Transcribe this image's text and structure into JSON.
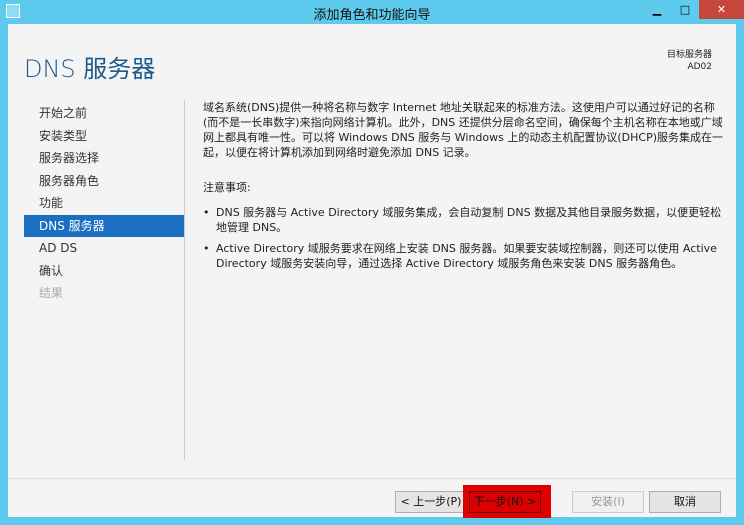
{
  "window": {
    "title": "添加角色和功能向导",
    "minimize": "▁",
    "maximize": "□",
    "close": "✕"
  },
  "header": {
    "title": "DNS 服务器",
    "target_label": "目标服务器",
    "target_value": "AD02"
  },
  "nav": [
    {
      "label": "开始之前",
      "state": "normal"
    },
    {
      "label": "安装类型",
      "state": "normal"
    },
    {
      "label": "服务器选择",
      "state": "normal"
    },
    {
      "label": "服务器角色",
      "state": "normal"
    },
    {
      "label": "功能",
      "state": "normal"
    },
    {
      "label": "DNS 服务器",
      "state": "selected"
    },
    {
      "label": "AD DS",
      "state": "normal"
    },
    {
      "label": "确认",
      "state": "normal"
    },
    {
      "label": "结果",
      "state": "disabled"
    }
  ],
  "content": {
    "intro": "域名系统(DNS)提供一种将名称与数字 Internet 地址关联起来的标准方法。这使用户可以通过好记的名称(而不是一长串数字)来指向网络计算机。此外，DNS 还提供分层命名空间，确保每个主机名称在本地或广域网上都具有唯一性。可以将 Windows DNS 服务与 Windows 上的动态主机配置协议(DHCP)服务集成在一起，以便在将计算机添加到网络时避免添加 DNS 记录。",
    "notes_title": "注意事项:",
    "notes": [
      "DNS 服务器与 Active Directory 域服务集成，会自动复制 DNS 数据及其他目录服务数据，以便更轻松地管理 DNS。",
      "Active Directory 域服务要求在网络上安装 DNS 服务器。如果要安装域控制器，则还可以使用 Active Directory 域服务安装向导，通过选择 Active Directory 域服务角色来安装 DNS 服务器角色。"
    ]
  },
  "footer": {
    "prev": "< 上一步(P)",
    "next": "下一步(N) >",
    "install": "安装(I)",
    "cancel": "取消"
  }
}
